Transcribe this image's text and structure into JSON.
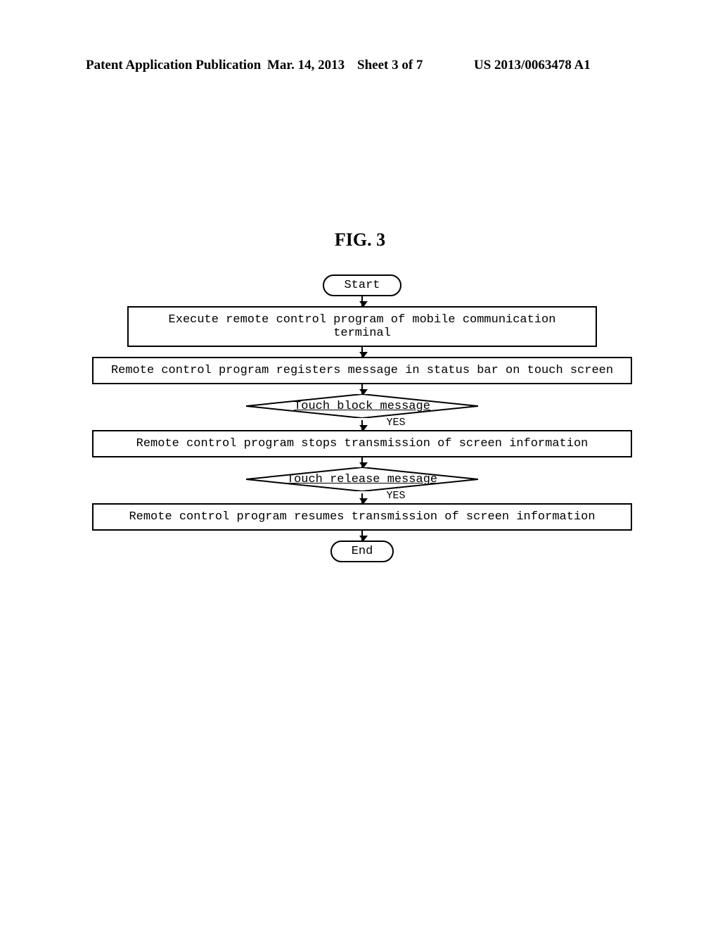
{
  "header": {
    "pub_type": "Patent Application Publication",
    "date": "Mar. 14, 2013",
    "sheet": "Sheet 3 of 7",
    "pub_no": "US 2013/0063478 A1"
  },
  "figure_label": "FIG. 3",
  "flow": {
    "start": "Start",
    "step1": "Execute remote control program of mobile communication terminal",
    "step2": "Remote control program registers message in status bar on touch screen",
    "decision1": "Touch block message",
    "yes1": "YES",
    "step3": "Remote control program stops transmission of screen information",
    "decision2": "Touch release message",
    "yes2": "YES",
    "step4": "Remote control program resumes transmission of screen information",
    "end": "End"
  }
}
